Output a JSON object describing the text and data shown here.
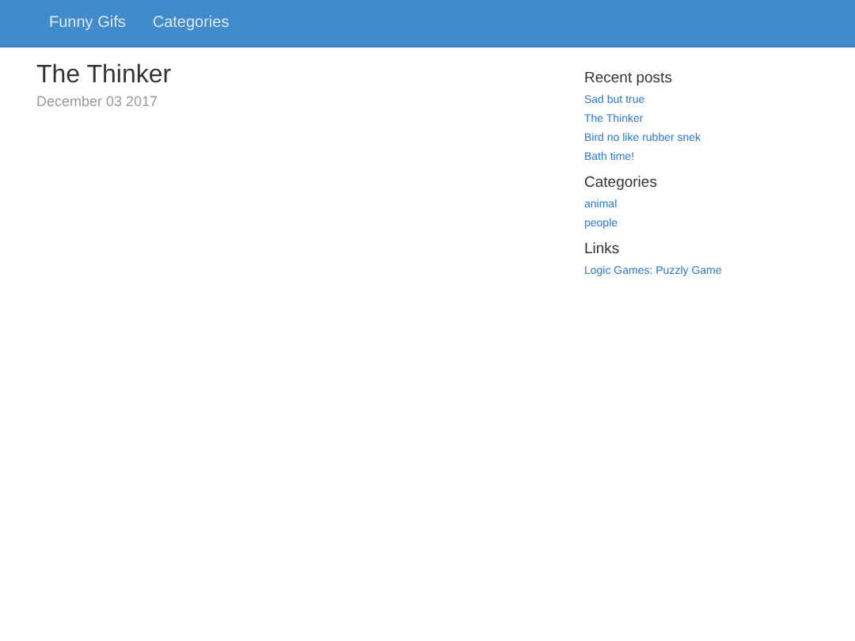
{
  "navbar": {
    "items": [
      {
        "label": "Funny Gifs"
      },
      {
        "label": "Categories"
      }
    ]
  },
  "post": {
    "title": "The Thinker",
    "date": "December 03 2017"
  },
  "sidebar": {
    "sections": [
      {
        "heading": "Recent posts",
        "links": [
          "Sad but true",
          "The Thinker",
          "Bird no like rubber snek",
          "Bath time!"
        ]
      },
      {
        "heading": "Categories",
        "links": [
          "animal",
          "people"
        ]
      },
      {
        "heading": "Links",
        "links": [
          "Logic Games: Puzzly Game"
        ]
      }
    ]
  }
}
